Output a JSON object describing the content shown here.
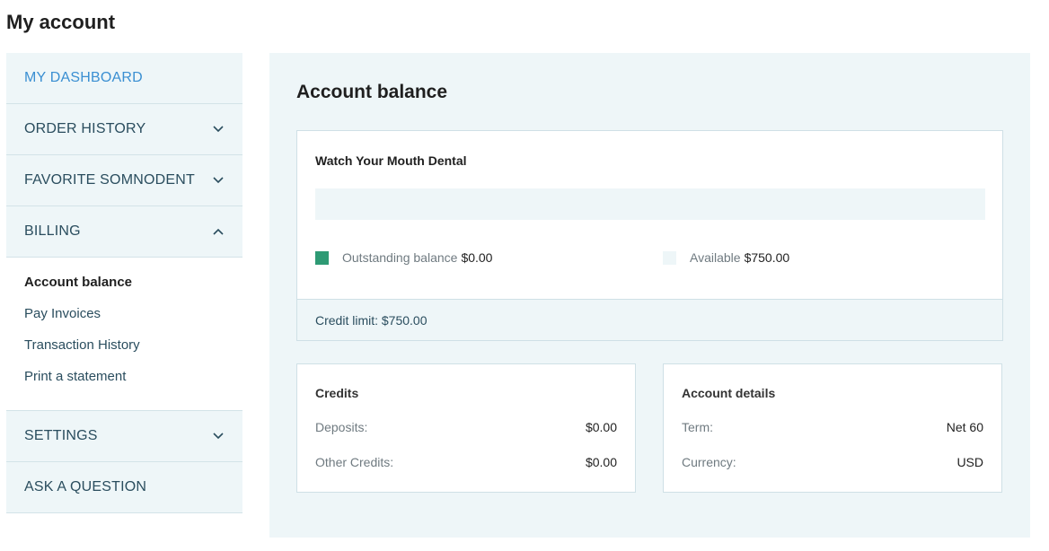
{
  "page_title": "My account",
  "sidebar": {
    "items": [
      {
        "label": "MY DASHBOARD"
      },
      {
        "label": "ORDER HISTORY"
      },
      {
        "label": "FAVORITE SOMNODENT"
      },
      {
        "label": "BILLING"
      },
      {
        "label": "SETTINGS"
      },
      {
        "label": "ASK A QUESTION"
      }
    ],
    "billing_sub": [
      {
        "label": "Account balance"
      },
      {
        "label": "Pay Invoices"
      },
      {
        "label": "Transaction History"
      },
      {
        "label": "Print a statement"
      }
    ]
  },
  "main": {
    "title": "Account balance",
    "company": "Watch Your Mouth Dental",
    "outstanding_fraction": 0,
    "outstanding_label": "Outstanding balance",
    "outstanding_value": "$0.00",
    "available_label": "Available",
    "available_value": "$750.00",
    "credit_limit": "Credit limit: $750.00",
    "credits": {
      "title": "Credits",
      "rows": [
        {
          "key": "Deposits:",
          "value": "$0.00"
        },
        {
          "key": "Other Credits:",
          "value": "$0.00"
        }
      ]
    },
    "details": {
      "title": "Account details",
      "rows": [
        {
          "key": "Term:",
          "value": "Net 60"
        },
        {
          "key": "Currency:",
          "value": "USD"
        }
      ]
    }
  },
  "colors": {
    "accent": "#3a8fd2",
    "panel_bg": "#eef6f8",
    "outstanding_swatch": "#2e9a74",
    "available_swatch": "#eef6f8"
  },
  "icons": {
    "chevron_down": "chevron-down-icon",
    "chevron_up": "chevron-up-icon"
  }
}
